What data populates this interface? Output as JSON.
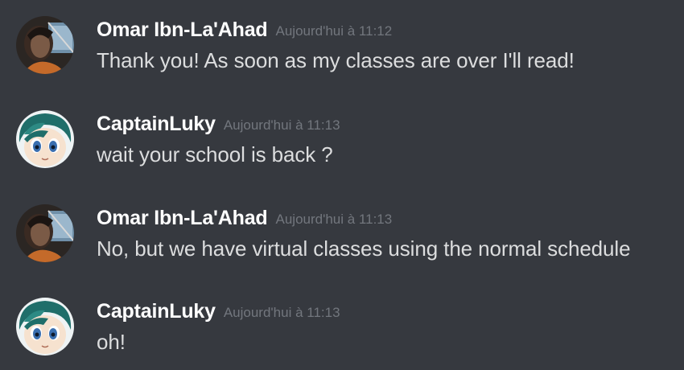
{
  "colors": {
    "background": "#36393f",
    "username": "#ffffff",
    "timestamp": "#72767d",
    "message_text": "#dcddde"
  },
  "messages": [
    {
      "author": "Omar Ibn-La'Ahad",
      "timestamp": "Aujourd'hui à 11:12",
      "text": "Thank you! As soon as my classes are over I'll read!",
      "avatar_icon": "omar-avatar"
    },
    {
      "author": "CaptainLuky",
      "timestamp": "Aujourd'hui à 11:13",
      "text": "wait your school is back ?",
      "avatar_icon": "captainluky-avatar"
    },
    {
      "author": "Omar Ibn-La'Ahad",
      "timestamp": "Aujourd'hui à 11:13",
      "text": "No, but we have virtual classes using the normal schedule",
      "avatar_icon": "omar-avatar"
    },
    {
      "author": "CaptainLuky",
      "timestamp": "Aujourd'hui à 11:13",
      "text": "oh!",
      "avatar_icon": "captainluky-avatar"
    }
  ]
}
